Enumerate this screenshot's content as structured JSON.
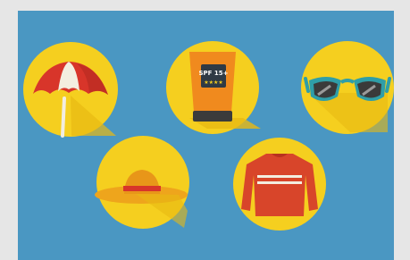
{
  "illustration": {
    "background_color": "#4a97c2",
    "circle_color": "#f5cf1f",
    "icons": [
      {
        "name": "beach-umbrella-icon"
      },
      {
        "name": "sunscreen-bottle-icon",
        "label": "SPF 15+",
        "rating": "★★★★"
      },
      {
        "name": "sunglasses-icon"
      },
      {
        "name": "sun-hat-icon"
      },
      {
        "name": "sweater-icon"
      }
    ]
  }
}
